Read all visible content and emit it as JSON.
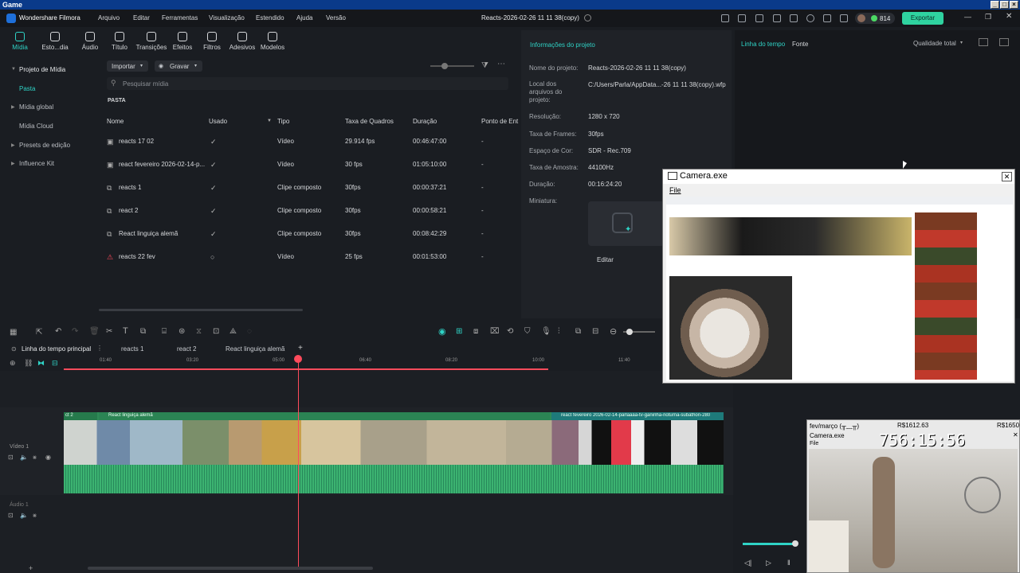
{
  "game_window": {
    "title": "Game"
  },
  "app": {
    "name": "Wondershare Filmora",
    "project_title": "Reacts-2026-02-26 11 11 38(copy)",
    "export_label": "Exportar",
    "credits": "814"
  },
  "menu": [
    "Arquivo",
    "Editar",
    "Ferramentas",
    "Visualização",
    "Estendido",
    "Ajuda",
    "Versão"
  ],
  "tools": [
    "Mídia",
    "Esto...dia",
    "Áudio",
    "Título",
    "Transições",
    "Efeitos",
    "Filtros",
    "Adesivos",
    "Modelos"
  ],
  "leftnav": {
    "items": [
      "Projeto de Mídia",
      "Pasta",
      "Mídia global",
      "Mídia Cloud",
      "Presets de edição",
      "Influence Kit"
    ]
  },
  "media": {
    "import_label": "Importar",
    "record_label": "Gravar",
    "search_placeholder": "Pesquisar mídia",
    "folder_label": "PASTA",
    "columns": [
      "Nome",
      "Usado",
      "Tipo",
      "Taxa de Quadros",
      "Duração",
      "Ponto de Ent"
    ],
    "rows": [
      {
        "name": "reacts 17 02",
        "type": "Vídeo",
        "fps": "29.914 fps",
        "duration": "00:46:47:00",
        "point": "-"
      },
      {
        "name": "react fevereiro 2026-02-14-p...",
        "type": "Vídeo",
        "fps": "30 fps",
        "duration": "01:05:10:00",
        "point": "-"
      },
      {
        "name": "reacts 1",
        "type": "Clipe composto",
        "fps": "30fps",
        "duration": "00:00:37:21",
        "point": "-"
      },
      {
        "name": "react 2",
        "type": "Clipe composto",
        "fps": "30fps",
        "duration": "00:00:58:21",
        "point": "-"
      },
      {
        "name": "React linguiça alemã",
        "type": "Clipe composto",
        "fps": "30fps",
        "duration": "00:08:42:29",
        "point": "-"
      },
      {
        "name": "reacts 22 fev",
        "type": "Vídeo",
        "fps": "25 fps",
        "duration": "00:01:53:00",
        "point": "-"
      }
    ]
  },
  "project_info": {
    "title": "Informações do projeto",
    "fields": [
      {
        "k": "Nome do projeto:",
        "v": "Reacts-2026-02-26 11 11 38(copy)"
      },
      {
        "k": "Local dos arquivos do projeto:",
        "v": "C:/Users/Parla/AppData...-26 11 11 38(copy).wfp"
      },
      {
        "k": "Resolução:",
        "v": "1280 x 720"
      },
      {
        "k": "Taxa de Frames:",
        "v": "30fps"
      },
      {
        "k": "Espaço de Cor:",
        "v": "SDR - Rec.709"
      },
      {
        "k": "Taxa de Amostra:",
        "v": "44100Hz"
      },
      {
        "k": "Duração:",
        "v": "00:16:24:20"
      },
      {
        "k": "Miniatura:",
        "v": ""
      }
    ],
    "edit_label": "Editar"
  },
  "right_panel": {
    "tabs": [
      "Linha do tempo",
      "Fonte"
    ],
    "quality": "Qualidade total"
  },
  "timeline": {
    "tabs": [
      "Linha do tempo principal",
      "reacts 1",
      "react 2",
      "React linguiça alemã"
    ],
    "ticks": [
      "01:40",
      "03:20",
      "05:00",
      "06:40",
      "08:20",
      "10:00",
      "11:40"
    ],
    "clip1": "React linguiça alemã",
    "clip0": "ct 2",
    "clip2": "react fevereiro 2026-02-14-parlaaaa-tv-ganinha-noturna-subathon-280",
    "tracks": [
      "Vídeo 1",
      "Áudio 1"
    ]
  },
  "camera": {
    "title": "Camera.exe",
    "menu": "File"
  },
  "camera2": {
    "header": "fev/março (╥﹏╥)",
    "amount1": "R$1612.63",
    "amount2": "R$1650",
    "title": "Camera.exe",
    "menu": "File",
    "timer": "756:15:56"
  },
  "colors": {
    "accent": "#2fd3c6",
    "playhead": "#ff4b5c",
    "clip": "#2e8b57",
    "audio": "#3cb371"
  }
}
